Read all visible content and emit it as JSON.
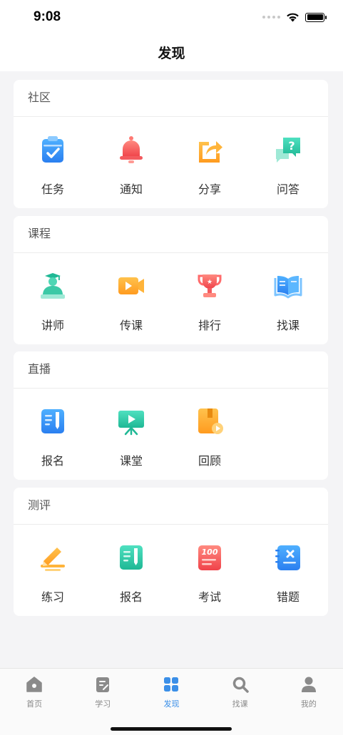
{
  "status": {
    "time": "9:08"
  },
  "nav": {
    "title": "发现"
  },
  "sections": [
    {
      "title": "社区",
      "items": [
        {
          "label": "任务",
          "icon": "task-clipboard-icon"
        },
        {
          "label": "通知",
          "icon": "bell-icon"
        },
        {
          "label": "分享",
          "icon": "share-icon"
        },
        {
          "label": "问答",
          "icon": "qa-chat-icon"
        }
      ]
    },
    {
      "title": "课程",
      "items": [
        {
          "label": "讲师",
          "icon": "teacher-icon"
        },
        {
          "label": "传课",
          "icon": "video-camera-icon"
        },
        {
          "label": "排行",
          "icon": "trophy-icon"
        },
        {
          "label": "找课",
          "icon": "open-book-icon"
        }
      ]
    },
    {
      "title": "直播",
      "items": [
        {
          "label": "报名",
          "icon": "signup-doc-icon"
        },
        {
          "label": "课堂",
          "icon": "classroom-screen-icon"
        },
        {
          "label": "回顾",
          "icon": "replay-book-icon"
        }
      ]
    },
    {
      "title": "测评",
      "items": [
        {
          "label": "练习",
          "icon": "pencil-practice-icon"
        },
        {
          "label": "报名",
          "icon": "signup-pen-icon"
        },
        {
          "label": "考试",
          "icon": "exam-100-icon"
        },
        {
          "label": "错题",
          "icon": "wrong-question-icon"
        }
      ]
    }
  ],
  "tabbar": {
    "items": [
      {
        "label": "首页",
        "icon": "home-icon"
      },
      {
        "label": "学习",
        "icon": "study-doc-icon"
      },
      {
        "label": "发现",
        "icon": "discover-grid-icon",
        "active": true
      },
      {
        "label": "找课",
        "icon": "search-icon"
      },
      {
        "label": "我的",
        "icon": "user-icon"
      }
    ],
    "active_color": "#3b8fe8",
    "inactive_color": "#8a8a8a"
  }
}
